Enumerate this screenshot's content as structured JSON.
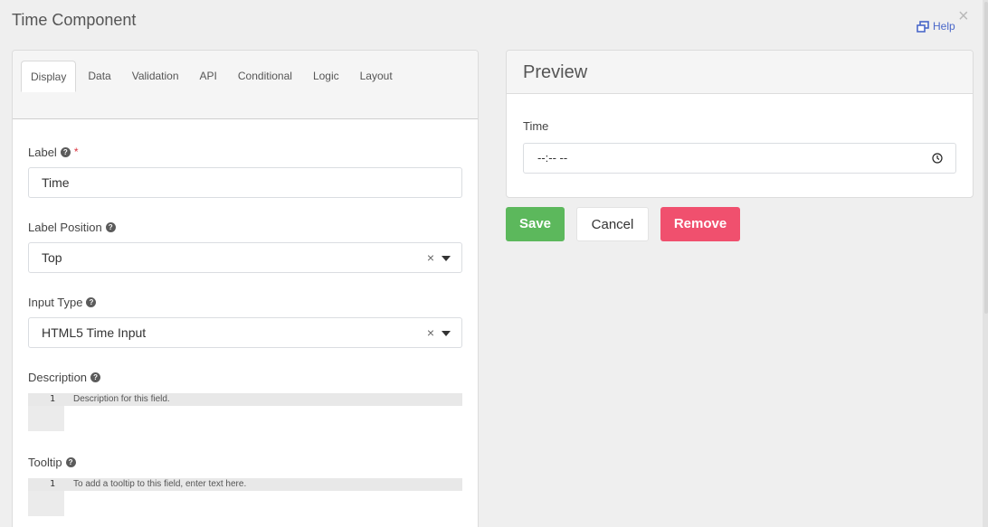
{
  "dialog": {
    "title": "Time Component",
    "help_label": "Help",
    "close_glyph": "×"
  },
  "tabs": [
    {
      "label": "Display",
      "active": true
    },
    {
      "label": "Data"
    },
    {
      "label": "Validation"
    },
    {
      "label": "API"
    },
    {
      "label": "Conditional"
    },
    {
      "label": "Logic"
    },
    {
      "label": "Layout"
    }
  ],
  "form": {
    "label_field": {
      "label": "Label",
      "required_mark": "*",
      "value": "Time"
    },
    "label_position": {
      "label": "Label Position",
      "value": "Top",
      "clear_glyph": "×"
    },
    "input_type": {
      "label": "Input Type",
      "value": "HTML5 Time Input",
      "clear_glyph": "×"
    },
    "description": {
      "label": "Description",
      "line_number": "1",
      "placeholder": "Description for this field."
    },
    "tooltip": {
      "label": "Tooltip",
      "line_number": "1",
      "placeholder": "To add a tooltip to this field, enter text here."
    }
  },
  "preview": {
    "title": "Preview",
    "field_label": "Time",
    "time_value": "--:-- --"
  },
  "buttons": {
    "save": "Save",
    "cancel": "Cancel",
    "remove": "Remove"
  },
  "colors": {
    "save": "#5cb85c",
    "remove": "#f0506e",
    "link": "#4a68c9",
    "required": "#d9333f"
  },
  "icons": {
    "help": "external-window-icon",
    "close": "close-icon",
    "question": "question-circle-icon",
    "clear": "clear-x-icon",
    "caret": "caret-down-icon",
    "clock": "clock-icon"
  }
}
